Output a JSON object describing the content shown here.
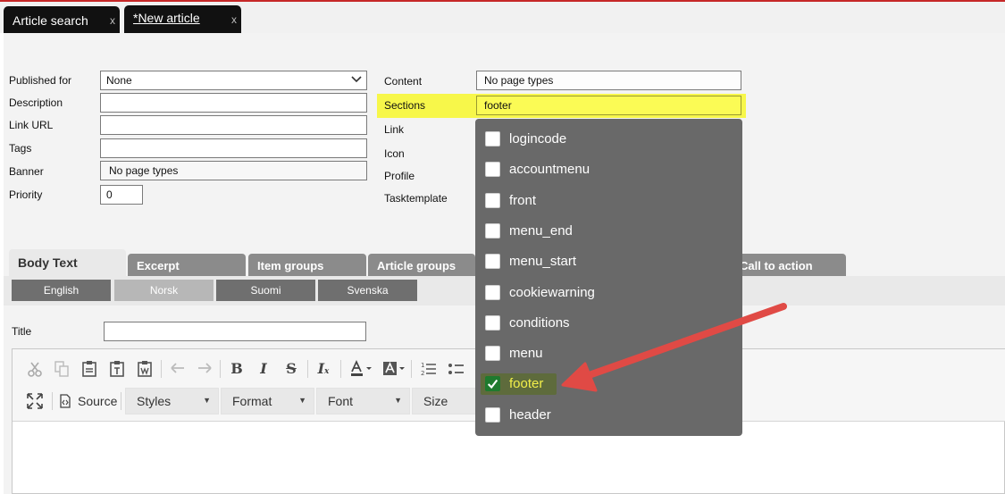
{
  "doc_tabs": [
    {
      "label": "Article search",
      "close": "x"
    },
    {
      "label": "*New article",
      "close": "x"
    }
  ],
  "form_left": {
    "published_for": {
      "label": "Published for",
      "value": "None"
    },
    "description": {
      "label": "Description",
      "value": ""
    },
    "link_url": {
      "label": "Link URL",
      "value": ""
    },
    "tags": {
      "label": "Tags",
      "value": ""
    },
    "banner": {
      "label": "Banner",
      "value": "No page types"
    },
    "priority": {
      "label": "Priority",
      "value": "0"
    }
  },
  "form_right": {
    "content": {
      "label": "Content",
      "value": "No page types"
    },
    "sections": {
      "label": "Sections",
      "value": "footer"
    },
    "link": {
      "label": "Link"
    },
    "icon": {
      "label": "Icon"
    },
    "profile": {
      "label": "Profile"
    },
    "tasktemplate": {
      "label": "Tasktemplate"
    }
  },
  "main_tabs": [
    "Body Text",
    "Excerpt",
    "Item groups",
    "Article groups",
    "Call to action"
  ],
  "lang_tabs": [
    "English",
    "Norsk",
    "Suomi",
    "Svenska"
  ],
  "title_field": {
    "label": "Title",
    "value": ""
  },
  "editor": {
    "source_label": "Source",
    "styles_label": "Styles",
    "format_label": "Format",
    "font_label": "Font",
    "size_label": "Size"
  },
  "sections_dropdown": {
    "options": [
      {
        "label": "logincode",
        "checked": false
      },
      {
        "label": "accountmenu",
        "checked": false
      },
      {
        "label": "front",
        "checked": false
      },
      {
        "label": "menu_end",
        "checked": false
      },
      {
        "label": "menu_start",
        "checked": false
      },
      {
        "label": "cookiewarning",
        "checked": false
      },
      {
        "label": "conditions",
        "checked": false
      },
      {
        "label": "menu",
        "checked": false
      },
      {
        "label": "footer",
        "checked": true
      },
      {
        "label": "header",
        "checked": false
      }
    ]
  },
  "colors": {
    "highlight": "#f7f74a",
    "arrow": "#e04a45",
    "tab_active_bg": "#111111",
    "dropdown_bg": "#696969"
  }
}
